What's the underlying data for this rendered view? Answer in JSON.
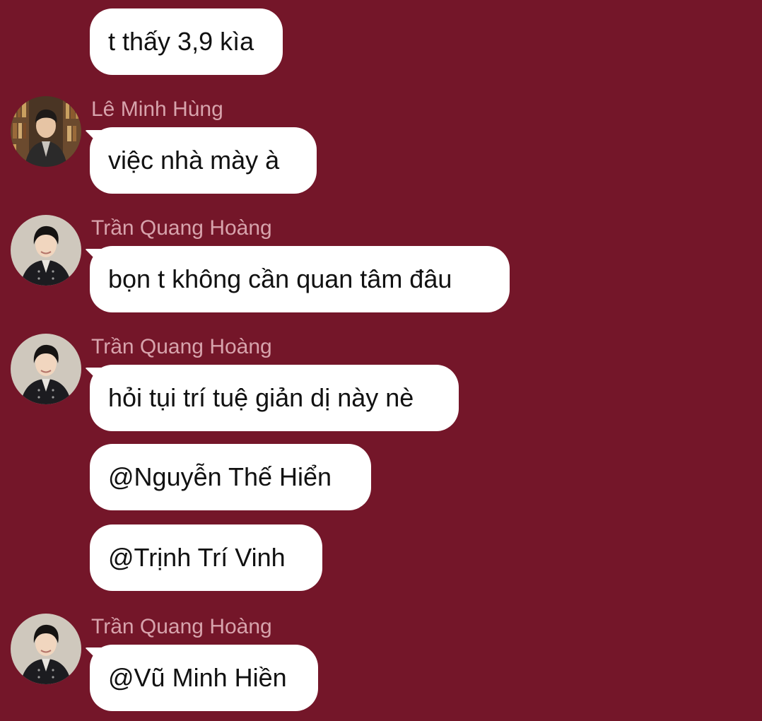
{
  "messages": [
    {
      "sender": null,
      "text": "t thấy 3,9 kìa"
    },
    {
      "sender": "Lê Minh Hùng",
      "text": "việc nhà mày à"
    },
    {
      "sender": "Trần Quang Hoàng",
      "text": "bọn t không cần quan tâm đâu"
    },
    {
      "sender": "Trần Quang Hoàng",
      "text": "hỏi tụi trí tuệ giản dị này nè"
    },
    {
      "sender": null,
      "text": "@Nguyễn Thế Hiển"
    },
    {
      "sender": null,
      "text": "@Trịnh Trí Vinh"
    },
    {
      "sender": "Trần Quang Hoàng",
      "text": "@Vũ Minh Hiền"
    }
  ],
  "colors": {
    "background": "#741629",
    "bubble": "#ffffff",
    "sender_name": "#d7a3ac",
    "message_text": "#111111"
  }
}
